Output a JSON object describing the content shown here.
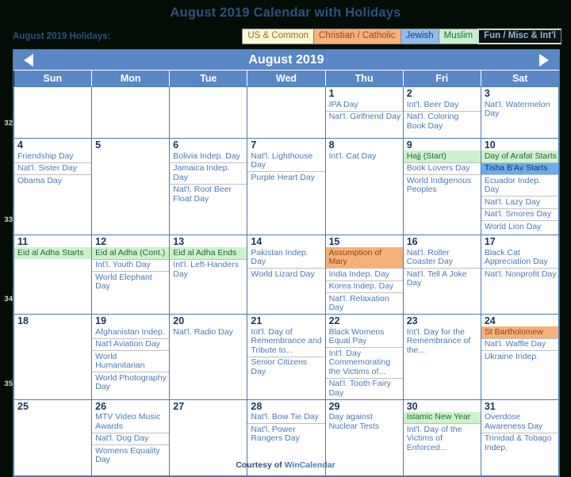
{
  "title": "August 2019 Calendar with Holidays",
  "legend": {
    "label": "August 2019 Holidays:",
    "keys": [
      {
        "name": "us-common",
        "label": "US & Common"
      },
      {
        "name": "christian-catholic",
        "label": "Christian / Catholic"
      },
      {
        "name": "jewish",
        "label": "Jewish"
      },
      {
        "name": "muslim",
        "label": "Muslim"
      },
      {
        "name": "fun-misc-intl",
        "label": "Fun / Misc & Int'l"
      }
    ],
    "colors": {
      "us": "#fdf7d7",
      "christian": "#f6b179",
      "jewish": "#8ebdee",
      "muslim": "#c9f0cc",
      "fun": "#0b1410"
    }
  },
  "nav": {
    "prev_label": "Previous month",
    "next_label": "Next month",
    "month_title": "August 2019"
  },
  "weekdays": [
    "Sun",
    "Mon",
    "Tue",
    "Wed",
    "Thu",
    "Fri",
    "Sat"
  ],
  "week_numbers": [
    "32",
    "33",
    "34",
    "35"
  ],
  "weeks": [
    {
      "week_number": "",
      "days": [
        {
          "num": "",
          "blank": true,
          "events": []
        },
        {
          "num": "",
          "blank": true,
          "events": []
        },
        {
          "num": "",
          "blank": true,
          "events": []
        },
        {
          "num": "",
          "blank": true,
          "events": []
        },
        {
          "num": "1",
          "events": [
            {
              "text": "IPA Day",
              "cat": "fun"
            },
            {
              "text": "Nat'l. Girlfriend Day",
              "cat": "fun"
            }
          ]
        },
        {
          "num": "2",
          "events": [
            {
              "text": "Int'l. Beer Day",
              "cat": "fun"
            },
            {
              "text": "Nat'l. Coloring Book Day",
              "cat": "fun"
            }
          ]
        },
        {
          "num": "3",
          "weekend": true,
          "events": [
            {
              "text": "Nat'l. Watermelon Day",
              "cat": "fun"
            }
          ]
        }
      ]
    },
    {
      "week_number": "32",
      "days": [
        {
          "num": "4",
          "weekend": true,
          "events": [
            {
              "text": "Friendship Day",
              "cat": "fun"
            },
            {
              "text": "Nat'l. Sister Day",
              "cat": "fun"
            },
            {
              "text": "Obama Day",
              "cat": "fun"
            }
          ]
        },
        {
          "num": "5",
          "events": []
        },
        {
          "num": "6",
          "events": [
            {
              "text": "Bolivia Indep. Day",
              "cat": "fun"
            },
            {
              "text": "Jamaica Indep. Day",
              "cat": "fun"
            },
            {
              "text": "Nat'l. Root Beer Float Day",
              "cat": "fun"
            }
          ]
        },
        {
          "num": "7",
          "events": [
            {
              "text": "Nat'l. Lighthouse Day",
              "cat": "fun"
            },
            {
              "text": "Purple Heart Day",
              "cat": "fun"
            }
          ]
        },
        {
          "num": "8",
          "events": [
            {
              "text": "Int'l. Cat Day",
              "cat": "fun"
            }
          ]
        },
        {
          "num": "9",
          "events": [
            {
              "text": "Hajj (Start)",
              "cat": "muslim"
            },
            {
              "text": "Book Lovers Day",
              "cat": "fun"
            },
            {
              "text": "World Indigenous Peoples",
              "cat": "fun"
            }
          ]
        },
        {
          "num": "10",
          "weekend": true,
          "events": [
            {
              "text": "Day of Arafat Starts",
              "cat": "muslim"
            },
            {
              "text": "Tisha B'Av Starts",
              "cat": "jewish"
            },
            {
              "text": "Ecuador Indep. Day",
              "cat": "fun"
            },
            {
              "text": "Nat'l. Lazy Day",
              "cat": "fun"
            },
            {
              "text": "Nat'l. Smores Day",
              "cat": "fun"
            },
            {
              "text": "World Lion Day",
              "cat": "fun"
            }
          ]
        }
      ]
    },
    {
      "week_number": "33",
      "days": [
        {
          "num": "11",
          "weekend": true,
          "events": [
            {
              "text": "Eid al Adha Starts",
              "cat": "muslim"
            }
          ]
        },
        {
          "num": "12",
          "events": [
            {
              "text": "Eid al Adha (Cont.)",
              "cat": "muslim"
            },
            {
              "text": "Int'l. Youth Day",
              "cat": "fun"
            },
            {
              "text": "World Elephant Day",
              "cat": "fun"
            }
          ]
        },
        {
          "num": "13",
          "events": [
            {
              "text": "Eid al Adha Ends",
              "cat": "muslim"
            },
            {
              "text": "Int'l. Left-Handers Day",
              "cat": "fun"
            }
          ]
        },
        {
          "num": "14",
          "events": [
            {
              "text": "Pakistan Indep. Day",
              "cat": "fun"
            },
            {
              "text": "World Lizard Day",
              "cat": "fun"
            }
          ]
        },
        {
          "num": "15",
          "events": [
            {
              "text": "Assumption of Mary",
              "cat": "christian"
            },
            {
              "text": "India Indep. Day",
              "cat": "fun"
            },
            {
              "text": "Korea Indep. Day",
              "cat": "fun"
            },
            {
              "text": "Nat'l. Relaxation Day",
              "cat": "fun"
            }
          ]
        },
        {
          "num": "16",
          "events": [
            {
              "text": "Nat'l. Roller Coaster Day",
              "cat": "fun"
            },
            {
              "text": "Nat'l. Tell A Joke Day",
              "cat": "fun"
            }
          ]
        },
        {
          "num": "17",
          "weekend": true,
          "events": [
            {
              "text": "Black Cat Appreciation Day",
              "cat": "fun"
            },
            {
              "text": "Nat'l. Nonprofit Day",
              "cat": "fun"
            }
          ]
        }
      ]
    },
    {
      "week_number": "34",
      "days": [
        {
          "num": "18",
          "weekend": true,
          "events": []
        },
        {
          "num": "19",
          "events": [
            {
              "text": "Afghanistan Indep.",
              "cat": "fun"
            },
            {
              "text": "Nat'l Aviation Day",
              "cat": "fun"
            },
            {
              "text": "World Humanitarian",
              "cat": "fun"
            },
            {
              "text": "World Photography Day",
              "cat": "fun"
            }
          ]
        },
        {
          "num": "20",
          "events": [
            {
              "text": "Nat'l. Radio Day",
              "cat": "fun"
            }
          ]
        },
        {
          "num": "21",
          "events": [
            {
              "text": "Int'l. Day of Remembrance and Tribute to...",
              "cat": "fun"
            },
            {
              "text": "Senior Citizens Day",
              "cat": "fun"
            }
          ]
        },
        {
          "num": "22",
          "events": [
            {
              "text": "Black Womens Equal Pay",
              "cat": "fun"
            },
            {
              "text": "Int'l. Day Commemorating the Victims of...",
              "cat": "fun"
            },
            {
              "text": "Nat'l. Tooth Fairy Day",
              "cat": "fun"
            }
          ]
        },
        {
          "num": "23",
          "events": [
            {
              "text": "Int'l. Day for the Remembrance of the...",
              "cat": "fun"
            }
          ]
        },
        {
          "num": "24",
          "weekend": true,
          "events": [
            {
              "text": "St Bartholomew",
              "cat": "christian"
            },
            {
              "text": "Nat'l. Waffle Day",
              "cat": "fun"
            },
            {
              "text": "Ukraine Indep.",
              "cat": "fun"
            }
          ]
        }
      ]
    },
    {
      "week_number": "35",
      "days": [
        {
          "num": "25",
          "weekend": true,
          "events": []
        },
        {
          "num": "26",
          "events": [
            {
              "text": "MTV Video Music Awards",
              "cat": "fun"
            },
            {
              "text": "Nat'l. Dog Day",
              "cat": "fun"
            },
            {
              "text": "Womens Equality Day",
              "cat": "fun"
            }
          ]
        },
        {
          "num": "27",
          "events": []
        },
        {
          "num": "28",
          "events": [
            {
              "text": "Nat'l. Bow Tie Day",
              "cat": "fun"
            },
            {
              "text": "Nat'l. Power Rangers Day",
              "cat": "fun"
            }
          ]
        },
        {
          "num": "29",
          "events": [
            {
              "text": "Day against Nuclear Tests",
              "cat": "fun"
            }
          ]
        },
        {
          "num": "30",
          "events": [
            {
              "text": "Islamic New Year",
              "cat": "muslim"
            },
            {
              "text": "Int'l. Day of the Victims of Enforced...",
              "cat": "fun"
            }
          ]
        },
        {
          "num": "31",
          "weekend": true,
          "events": [
            {
              "text": "Overdose Awareness Day",
              "cat": "fun"
            },
            {
              "text": "Trinidad & Tobago Indep.",
              "cat": "fun"
            }
          ]
        }
      ]
    }
  ],
  "footer": {
    "prefix": "Courtesy of ",
    "brand": "WinCalendar"
  }
}
